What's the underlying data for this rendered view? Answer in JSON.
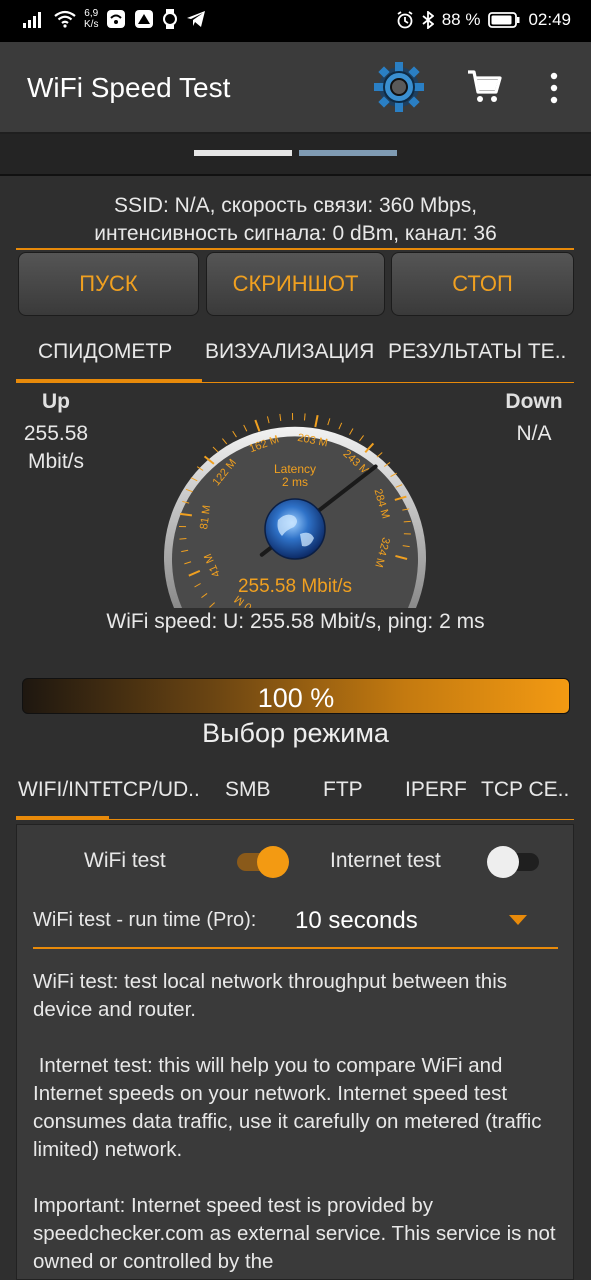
{
  "status_bar": {
    "net_speed_value": "6,9",
    "net_speed_unit": "K/s",
    "battery_percent": "88 %",
    "time": "02:49"
  },
  "app": {
    "title": "WiFi Speed Test"
  },
  "network_info": {
    "line1": "SSID: N/A, скорость связи: 360 Mbps,",
    "line2": "интенсивность сигнала: 0 dBm, канал: 36"
  },
  "buttons": {
    "start": "ПУСК",
    "screenshot": "СКРИНШОТ",
    "stop": "СТОП"
  },
  "main_tabs": [
    {
      "label": "СПИДОМЕТР",
      "active": true
    },
    {
      "label": "ВИЗУАЛИЗАЦИЯ",
      "active": false
    },
    {
      "label": "РЕЗУЛЬТАТЫ ТЕ..",
      "active": false
    }
  ],
  "speedometer": {
    "up_label": "Up",
    "up_value": "255.58",
    "up_unit": "Mbit/s",
    "down_label": "Down",
    "down_value": "N/A",
    "latency_label": "Latency",
    "latency_value": "2 ms",
    "readout": "255.58 Mbit/s",
    "scale_labels": [
      "0 M",
      "41 M",
      "81 M",
      "122 M",
      "162 M",
      "203 M",
      "243 M",
      "284 M",
      "324 M"
    ],
    "needle_value_mbps": 255.58,
    "scale_max_mbps": 324
  },
  "summary": "WiFi speed: U: 255.58 Mbit/s, ping: 2 ms",
  "progress": {
    "label": "100 %",
    "value": 1.0
  },
  "mode_title": "Выбор режима",
  "mode_tabs": [
    {
      "label": "WIFI/INTE",
      "active": true
    },
    {
      "label": "TCP/UD..",
      "active": false
    },
    {
      "label": "SMB",
      "active": false
    },
    {
      "label": "FTP",
      "active": false
    },
    {
      "label": "IPERF",
      "active": false
    },
    {
      "label": "TCP CE..",
      "active": false
    }
  ],
  "options": {
    "wifi_test_label": "WiFi test",
    "wifi_test_on": true,
    "internet_test_label": "Internet test",
    "internet_test_on": false,
    "runtime_label": "WiFi test - run time (Pro):",
    "runtime_value": "10 seconds"
  },
  "description": [
    "WiFi test: test local network throughput between this device and router.",
    " Internet test: this will help you to compare WiFi and Internet speeds on your network. Internet speed test consumes data traffic, use it carefully on metered (traffic limited) network.",
    "Important: Internet speed test is provided by speedchecker.com as external service. This service is not owned or controlled by the"
  ],
  "colors": {
    "accent": "#e88a0a",
    "background": "#2f2f2f"
  }
}
